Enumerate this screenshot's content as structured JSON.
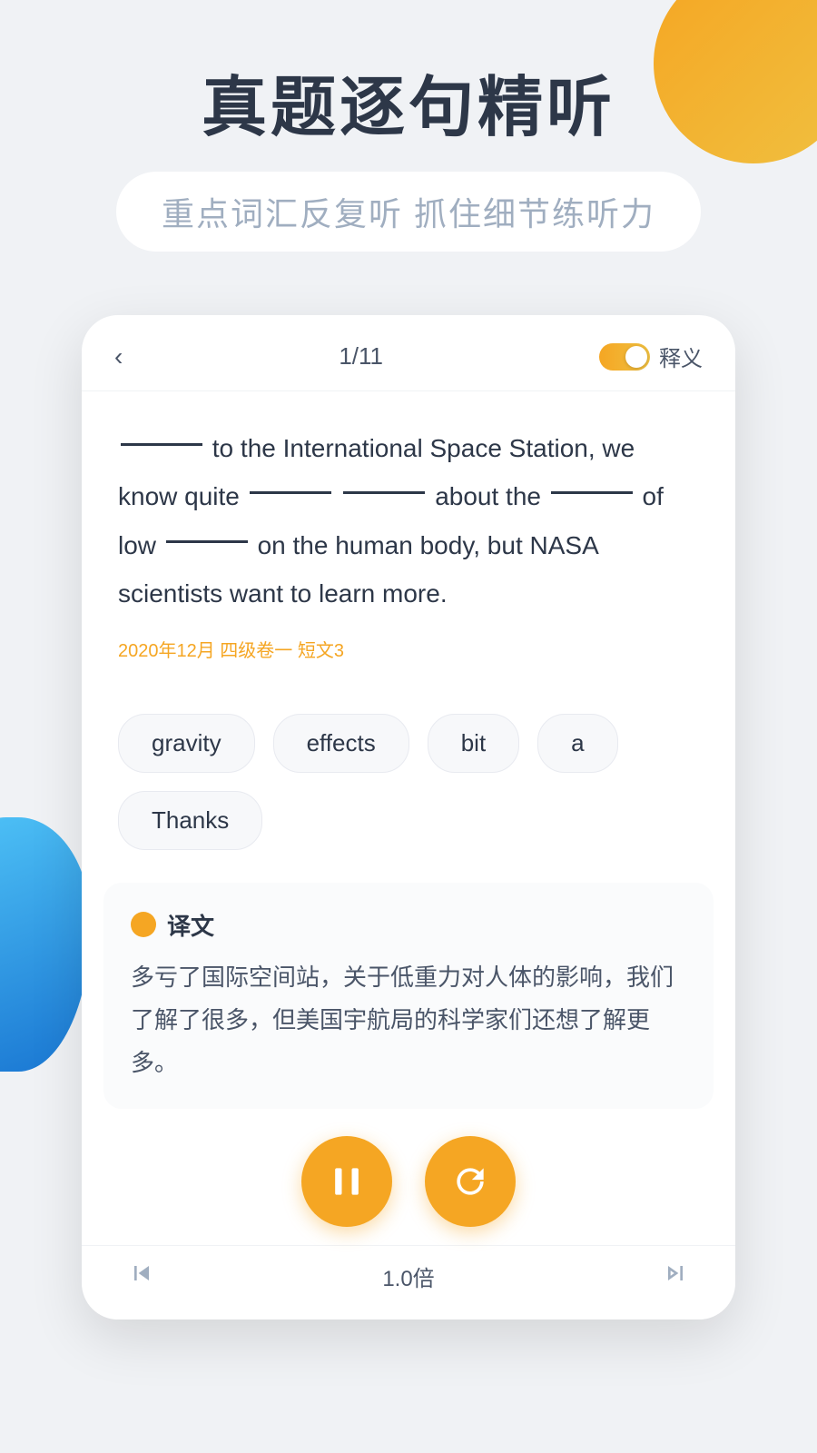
{
  "background": {
    "circle_color": "#f5a623",
    "blob_color": "#1976d2"
  },
  "header": {
    "title": "真题逐句精听",
    "subtitle": "重点词汇反复听  抓住细节练听力"
  },
  "nav": {
    "back_icon": "‹",
    "progress": "1/11",
    "toggle_on": true,
    "label": "释义"
  },
  "passage": {
    "text_parts": [
      "________ to the International Space Station, we know quite ________ ________ about the ________ of low ________ on the human body, but NASA scientists want to learn more."
    ],
    "meta": "2020年12月  四级卷一  短文3"
  },
  "word_options": [
    {
      "word": "gravity"
    },
    {
      "word": "effects"
    },
    {
      "word": "bit"
    },
    {
      "word": "a"
    },
    {
      "word": "Thanks"
    }
  ],
  "translation": {
    "dot_color": "#f5a623",
    "label": "译文",
    "text": "多亏了国际空间站，关于低重力对人体的影响，我们了解了很多，但美国宇航局的科学家们还想了解更多。"
  },
  "controls": {
    "pause_icon": "pause",
    "refresh_icon": "refresh"
  },
  "playback": {
    "prev_icon": "|◄",
    "speed": "1.0倍",
    "next_icon": "►|"
  }
}
